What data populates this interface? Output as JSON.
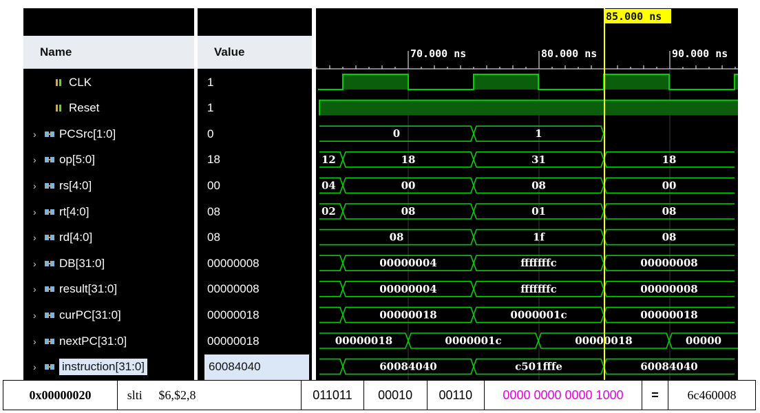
{
  "headers": {
    "name": "Name",
    "value": "Value"
  },
  "cursor_time": "85.000 ns",
  "time_ticks": [
    "70.000 ns",
    "80.000 ns",
    "90.000 ns"
  ],
  "signals": [
    {
      "name": "CLK",
      "value": "1",
      "bus": false
    },
    {
      "name": "Reset",
      "value": "1",
      "bus": false
    },
    {
      "name": "PCSrc[1:0]",
      "value": "0",
      "bus": true
    },
    {
      "name": "op[5:0]",
      "value": "18",
      "bus": true
    },
    {
      "name": "rs[4:0]",
      "value": "00",
      "bus": true
    },
    {
      "name": "rt[4:0]",
      "value": "08",
      "bus": true
    },
    {
      "name": "rd[4:0]",
      "value": "08",
      "bus": true
    },
    {
      "name": "DB[31:0]",
      "value": "00000008",
      "bus": true
    },
    {
      "name": "result[31:0]",
      "value": "00000008",
      "bus": true
    },
    {
      "name": "curPC[31:0]",
      "value": "00000018",
      "bus": true
    },
    {
      "name": "nextPC[31:0]",
      "value": "00000018",
      "bus": true
    },
    {
      "name": "instruction[31:0]",
      "value": "60084040",
      "bus": true
    }
  ],
  "bus_segments": [
    [
      {
        "label": "0"
      },
      {
        "label": "1"
      }
    ],
    [
      {
        "label": "12"
      },
      {
        "label": "18"
      },
      {
        "label": "31"
      },
      {
        "label": "18"
      }
    ],
    [
      {
        "label": "04"
      },
      {
        "label": "00"
      },
      {
        "label": "08"
      },
      {
        "label": "00"
      }
    ],
    [
      {
        "label": "02"
      },
      {
        "label": "08"
      },
      {
        "label": "01"
      },
      {
        "label": "08"
      }
    ],
    [
      {
        "label": "08"
      },
      {
        "label": "1f"
      },
      {
        "label": "08"
      }
    ],
    [
      {
        "label": ""
      },
      {
        "label": "00000004"
      },
      {
        "label": "fffffffc"
      },
      {
        "label": "00000008"
      }
    ],
    [
      {
        "label": ""
      },
      {
        "label": "00000004"
      },
      {
        "label": "fffffffc"
      },
      {
        "label": "00000008"
      }
    ],
    [
      {
        "label": ""
      },
      {
        "label": "00000018"
      },
      {
        "label": "0000001c"
      },
      {
        "label": "00000018"
      }
    ],
    [
      {
        "label": "00000018"
      },
      {
        "label": "0000001c"
      },
      {
        "label": "00000018"
      },
      {
        "label": "00000"
      }
    ],
    [
      {
        "label": ""
      },
      {
        "label": "60084040"
      },
      {
        "label": "c501fffe"
      },
      {
        "label": "60084040"
      }
    ]
  ],
  "instruction_row": {
    "address": "0x00000020",
    "mnemonic": "slti",
    "operands": "$6,$2,8",
    "op": "011011",
    "rs": "00010",
    "rt": "00110",
    "imm": "0000 0000 0000 1000",
    "eq": "=",
    "hex": "6c460008"
  },
  "colors": {
    "wave": "#00d000",
    "wave_fill": "#0b5e0b",
    "cursor": "#ffff00",
    "imm_text": "#e600e6"
  }
}
